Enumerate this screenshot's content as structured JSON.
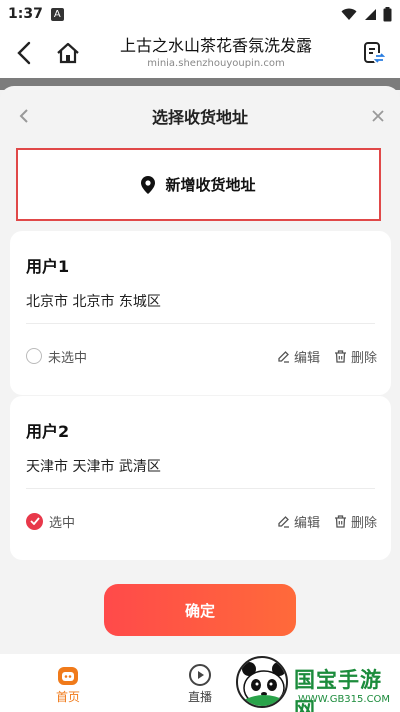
{
  "status_bar": {
    "time": "1:37",
    "notif_letter": "A"
  },
  "header": {
    "title": "上古之水山茶花香氛洗发露",
    "url": "minia.shenzhouyoupin.com"
  },
  "sheet": {
    "title": "选择收货地址",
    "add_address_label": "新增收货地址",
    "addresses": [
      {
        "name": "用户1",
        "region": "北京市 北京市 东城区",
        "status": "未选中",
        "selected": false,
        "edit_label": "编辑",
        "delete_label": "删除"
      },
      {
        "name": "用户2",
        "region": "天津市 天津市 武清区",
        "status": "选中",
        "selected": true,
        "edit_label": "编辑",
        "delete_label": "删除"
      }
    ],
    "confirm_label": "确定"
  },
  "tabs": [
    {
      "label": "首页",
      "icon": "home-bag-icon",
      "active": true
    },
    {
      "label": "直播",
      "icon": "play-icon",
      "active": false
    }
  ],
  "watermark": {
    "brand": "国宝手游网",
    "url": "WWW.GB315.COM"
  },
  "colors": {
    "accent": "#e8384a",
    "highlight_border": "#e04848",
    "active_tab": "#f07a1a",
    "watermark": "#1c8c3c"
  }
}
